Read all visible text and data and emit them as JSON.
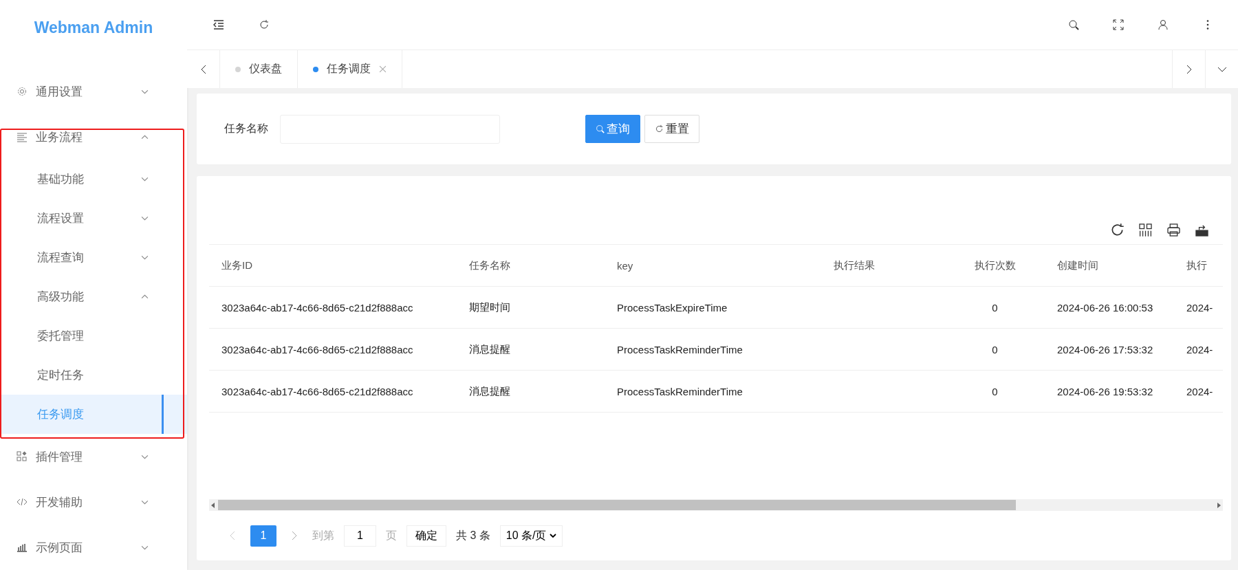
{
  "brand": "Webman Admin",
  "sidebar": {
    "items": [
      {
        "label": "通用设置",
        "expanded": false,
        "selected": false
      },
      {
        "label": "业务流程",
        "expanded": true,
        "selected": false,
        "children": [
          {
            "label": "基础功能",
            "expanded": false,
            "selected": false
          },
          {
            "label": "流程设置",
            "expanded": false,
            "selected": false
          },
          {
            "label": "流程查询",
            "expanded": false,
            "selected": false
          },
          {
            "label": "高级功能",
            "expanded": true,
            "selected": false,
            "children": [
              {
                "label": "委托管理",
                "selected": false
              },
              {
                "label": "定时任务",
                "selected": false
              },
              {
                "label": "任务调度",
                "selected": true
              }
            ]
          }
        ]
      },
      {
        "label": "插件管理",
        "expanded": false,
        "selected": false
      },
      {
        "label": "开发辅助",
        "expanded": false,
        "selected": false
      },
      {
        "label": "示例页面",
        "expanded": false,
        "selected": false
      }
    ]
  },
  "tabs": [
    {
      "label": "仪表盘",
      "selected": false,
      "closable": false
    },
    {
      "label": "任务调度",
      "selected": true,
      "closable": true
    }
  ],
  "search": {
    "label": "任务名称",
    "query_button": "查询",
    "reset_button": "重置"
  },
  "table": {
    "columns": [
      "业务ID",
      "任务名称",
      "key",
      "执行结果",
      "执行次数",
      "创建时间",
      "执行"
    ],
    "rows": [
      [
        "3023a64c-ab17-4c66-8d65-c21d2f888acc",
        "期望时间",
        "ProcessTaskExpireTime",
        "",
        "0",
        "2024-06-26 16:00:53",
        "2024-"
      ],
      [
        "3023a64c-ab17-4c66-8d65-c21d2f888acc",
        "消息提醒",
        "ProcessTaskReminderTime",
        "",
        "0",
        "2024-06-26 17:53:32",
        "2024-"
      ],
      [
        "3023a64c-ab17-4c66-8d65-c21d2f888acc",
        "消息提醒",
        "ProcessTaskReminderTime",
        "",
        "0",
        "2024-06-26 19:53:32",
        "2024-"
      ]
    ]
  },
  "pagination": {
    "current_page": "1",
    "goto_label": "到第",
    "goto_value": "1",
    "page_unit": "页",
    "confirm": "确定",
    "total": "共 3 条",
    "page_size": "10 条/页"
  }
}
